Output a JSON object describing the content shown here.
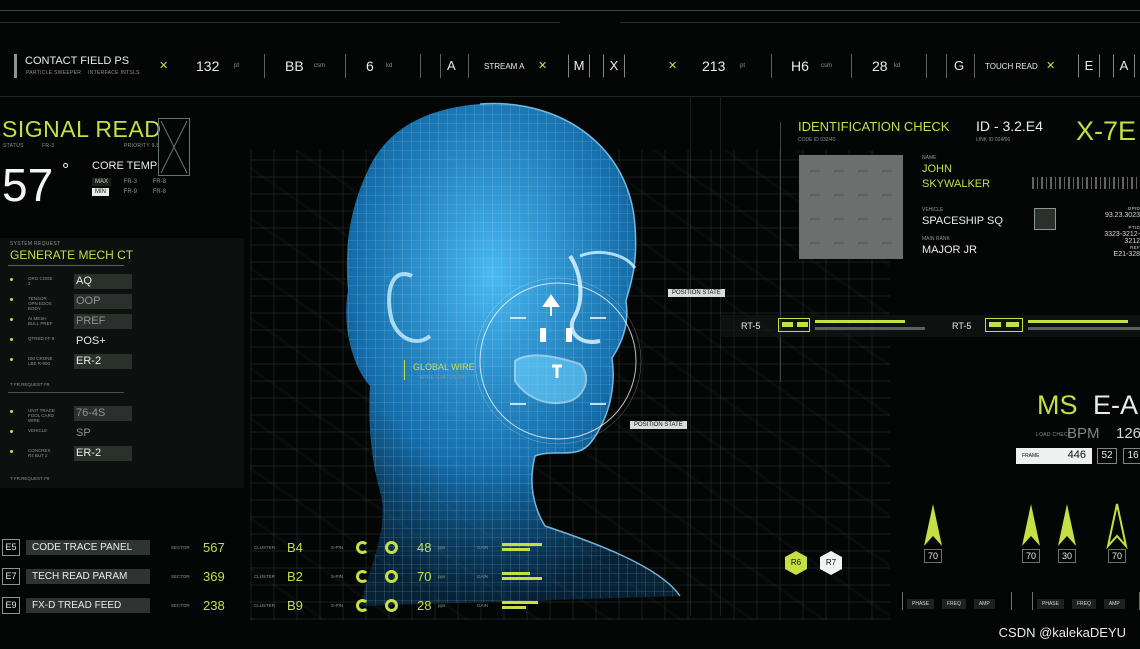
{
  "topbar": {
    "title": "CONTACT FIELD PS",
    "sub1": "PARTICLE SWEEPER",
    "sub2": "INTERFACE INTSLS",
    "v1": "132",
    "u1": "pt",
    "v2": "BB",
    "u2": "csm",
    "v3": "6",
    "u3": "kd",
    "l1": "A",
    "stream": "STREAM A",
    "b1": "M",
    "b2": "X",
    "v4": "213",
    "u4": "pt",
    "v5": "H6",
    "u5": "csm",
    "v6": "28",
    "u6": "kd",
    "l2": "G",
    "touch": "TOUCH READ",
    "b3": "E",
    "b4": "A"
  },
  "signal": {
    "title": "SIGNAL READ",
    "status": "STATUS",
    "status_v": "FR-3",
    "priority": "PRIORITY 9.8",
    "temp": "57",
    "deg": "°",
    "core": "CORE TEMP",
    "max": "MAX",
    "min": "MIN",
    "max_a": "FR-3",
    "max_b": "FR-8",
    "min_a": "FR-9",
    "min_b": "FR-8"
  },
  "mech": {
    "header": "SYSTEM REQUEST",
    "title": "GENERATE MECH CT",
    "rows": [
      {
        "label": "ORG CODE 2",
        "value": "AQ"
      },
      {
        "label": "TENSOR OPN EDOS BODY",
        "value": "OOP"
      },
      {
        "label": "AI MESH BULL PREF",
        "value": "PREF"
      },
      {
        "label": "QTRED FF 9",
        "value": "POS+"
      },
      {
        "label": "DM CRONE LBE R-900",
        "value": "ER-2"
      }
    ],
    "foot1": "T FR.REQUEST F9",
    "rows2": [
      {
        "label": "UNIT TRACE FOOL CARD WIRE",
        "value": "76-4S"
      },
      {
        "label": "VEHICLE",
        "value": "SP"
      },
      {
        "label": "CONCREX R4 BUT 2",
        "value": "ER-2"
      }
    ],
    "foot2": "T FR.REQUEST F9"
  },
  "tags": {
    "position1": "POSITION STATE",
    "position2": "POSITION STATE",
    "global_wire": "GLOBAL WIRE",
    "global_sub": "WIRE STATUS 09"
  },
  "identification": {
    "title": "IDENTIFICATION CHECK",
    "code": "CODE ID 032/43",
    "id": "ID - 3.2.E4",
    "link": "LINK ID 024/66",
    "big": "X-7E",
    "photo": "photo",
    "name_lbl": "NAME",
    "name1": "JOHN",
    "name2": "SKYWALKER",
    "vehicle_lbl": "VEHICLE",
    "vehicle": "SPACESHIP SQ",
    "rank_lbl": "MAIN RANK",
    "rank": "MAJOR JR",
    "n1_lbl": "OPID",
    "n1": "93.23.3023",
    "n2_lbl": "PTID",
    "n2": "3323-3212-3212",
    "n3_lbl": "REF",
    "n3": "E21-328"
  },
  "rt": {
    "label1": "RT-5",
    "label2": "RT-5"
  },
  "ms": {
    "ms": "MS",
    "ea": "E-A",
    "load": "LOAD CHECK",
    "bpm": "BPM",
    "bpm_val": "126",
    "frame": "FRAME",
    "frame_val": "446",
    "n1": "52",
    "n2": "16"
  },
  "arrows": {
    "a1": "70",
    "a2": "70",
    "a3": "30",
    "a4": "70"
  },
  "hexes": {
    "h1": "R6",
    "h2": "R7"
  },
  "buttons": {
    "phase": "PHASE",
    "freq": "FREQ",
    "amp": "AMP"
  },
  "bottom": {
    "sector": "SECTOR",
    "cluster": "CLUSTER",
    "spin": "S-PIN",
    "gain": "GAIN",
    "unit": "pps",
    "rows": [
      {
        "code": "E5",
        "name": "CODE TRACE PANEL",
        "sector": "567",
        "cluster": "B4",
        "count": "48"
      },
      {
        "code": "E7",
        "name": "TECH READ PARAM",
        "sector": "369",
        "cluster": "B2",
        "count": "70"
      },
      {
        "code": "E9",
        "name": "FX-D TREAD FEED",
        "sector": "238",
        "cluster": "B9",
        "count": "28"
      }
    ]
  },
  "watermark": "CSDN @kalekaDEYU",
  "colors": {
    "accent": "#c6df45",
    "hologram": "#1aa3ff",
    "background": "#030605"
  }
}
